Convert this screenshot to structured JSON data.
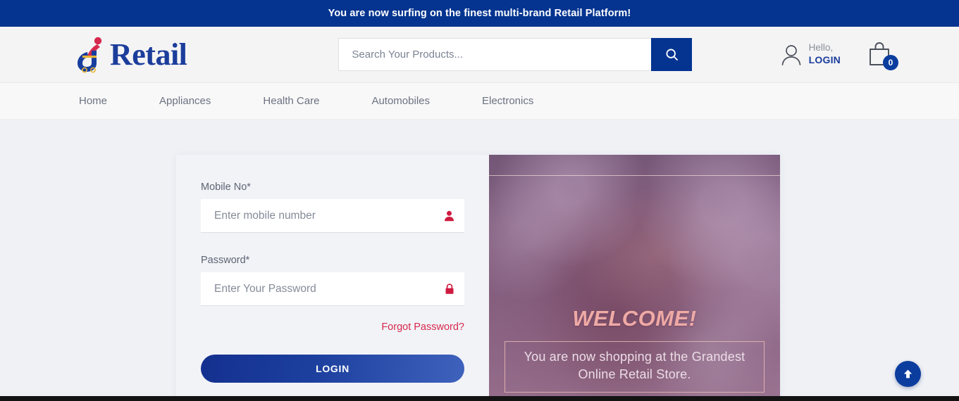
{
  "banner": {
    "message": "You are now surfing on the finest multi-brand Retail Platform!",
    "background_color": "#043490",
    "text_color": "#ffffff"
  },
  "header": {
    "logo_text": "Retail",
    "logo_icon": "retail-shopper-logo",
    "logo_colors": {
      "blue": "#1b3d9b",
      "red": "#d6294e",
      "yellow": "#e8b634"
    },
    "search": {
      "placeholder": "Search Your Products...",
      "value": "",
      "button_icon": "search-icon",
      "button_color": "#043490"
    },
    "account": {
      "icon": "user-icon",
      "greeting": "Hello,",
      "action_label": "LOGIN",
      "action_color": "#1b3d9b"
    },
    "cart": {
      "icon": "shopping-bag-icon",
      "count": "0",
      "badge_color": "#0b3d9e"
    }
  },
  "nav": {
    "items": [
      {
        "label": "Home"
      },
      {
        "label": "Appliances"
      },
      {
        "label": "Health Care"
      },
      {
        "label": "Automobiles"
      },
      {
        "label": "Electronics"
      }
    ]
  },
  "login_form": {
    "mobile": {
      "label": "Mobile No*",
      "placeholder": "Enter mobile number",
      "value": "",
      "icon": "user-icon",
      "icon_color": "#cf1a3f"
    },
    "password": {
      "label": "Password*",
      "placeholder": "Enter Your Password",
      "value": "",
      "icon": "lock-icon",
      "icon_color": "#cf1a3f"
    },
    "forgot_password_label": "Forgot Password?",
    "forgot_password_color": "#d6294e",
    "submit_label": "LOGIN",
    "submit_gradient": [
      "#14308f",
      "#3f62bd"
    ]
  },
  "hero": {
    "image_alt": "smiling-woman-photo",
    "heading": "WELCOME!",
    "heading_color": "#efaaa5",
    "subheading": "You are now shopping at the Grandest Online Retail Store.",
    "overlay_color": "#8a5684"
  },
  "scroll_top": {
    "icon": "arrow-up-icon",
    "color": "#0b3d9e"
  }
}
